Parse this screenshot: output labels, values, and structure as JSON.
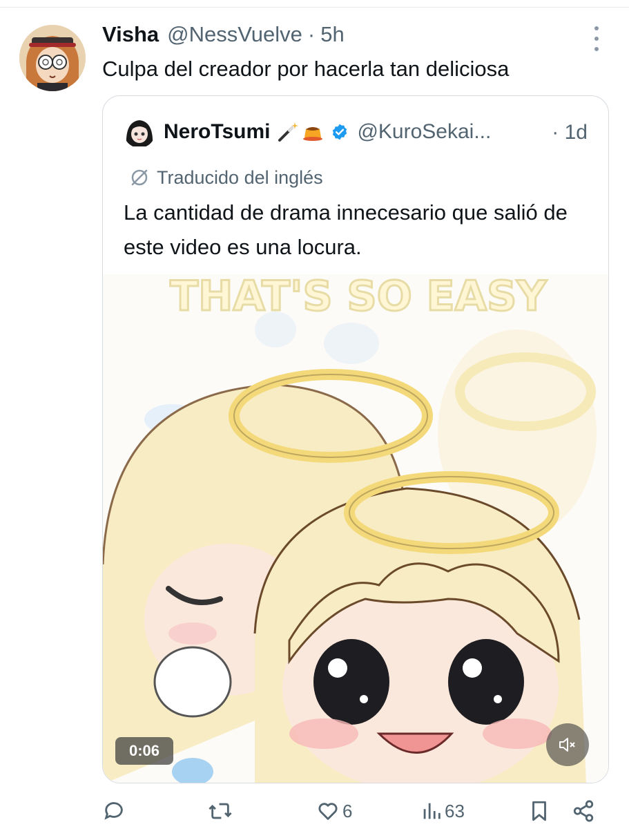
{
  "tweet": {
    "display_name": "Visha",
    "handle": "@NessVuelve",
    "separator": "·",
    "time": "5h",
    "text": "Culpa del creador por hacerla tan deliciosa"
  },
  "quote": {
    "display_name": "NeroTsumi",
    "emojis": "🪄🍮",
    "handle": "@KuroSekai...",
    "time": "· 1d",
    "translated_label": "Traducido del inglés",
    "text": "La cantidad de drama innecesario que salió de este video es una locura.",
    "media": {
      "overlay_text": "THAT'S SO EASY",
      "duration": "0:06"
    }
  },
  "actions": {
    "reply_icon": "reply-icon",
    "repost_icon": "repost-icon",
    "like_count": "6",
    "views_count": "63"
  },
  "colors": {
    "text": "#0f1419",
    "secondary": "#536471",
    "border": "#d6dbe0",
    "verified": "#1d9bf0"
  }
}
